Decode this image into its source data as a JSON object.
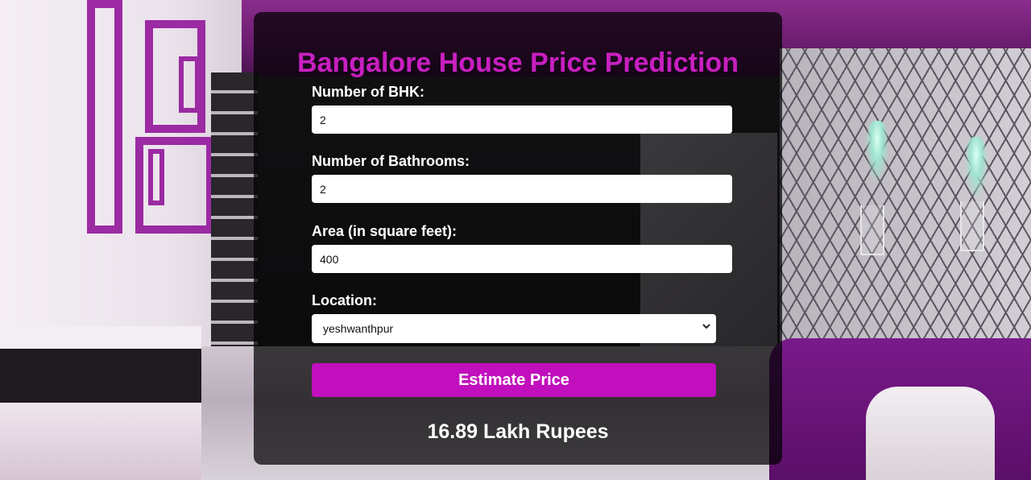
{
  "app": {
    "title": "Bangalore House Price Prediction",
    "accent_color": "#c10fbd"
  },
  "form": {
    "bhk": {
      "label": "Number of BHK:",
      "value": "2"
    },
    "bathrooms": {
      "label": "Number of Bathrooms:",
      "value": "2"
    },
    "area": {
      "label": "Area (in square feet):",
      "value": "400"
    },
    "location": {
      "label": "Location:",
      "selected": "yeshwanthpur",
      "icon": "chevron-down-icon"
    },
    "submit_label": "Estimate Price"
  },
  "result": {
    "text": "16.89 Lakh Rupees"
  }
}
